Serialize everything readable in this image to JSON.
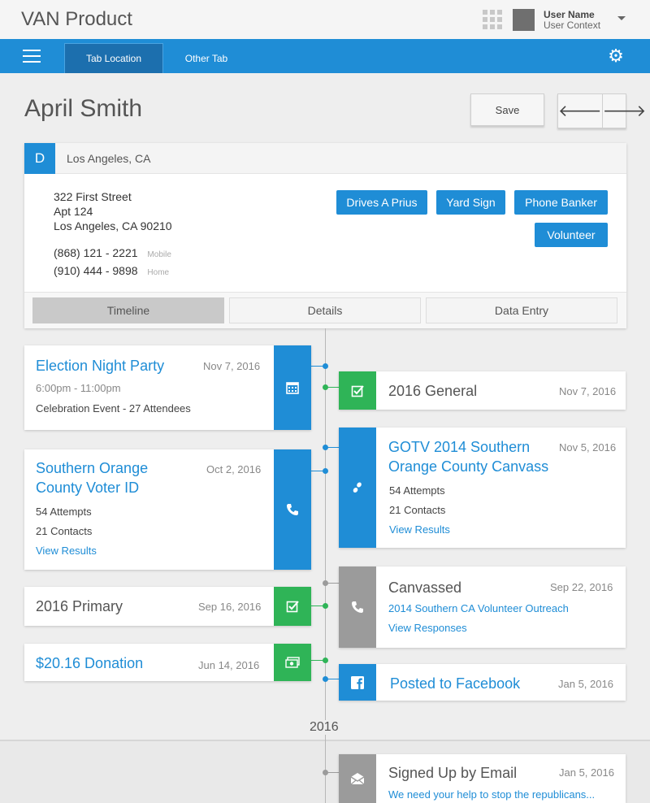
{
  "app": {
    "brand": "VAN Product",
    "user_name": "User Name",
    "user_context": "User Context"
  },
  "nav": {
    "tabs": [
      "Tab Location",
      "Other Tab"
    ]
  },
  "person": {
    "name": "April Smith",
    "save_label": "Save",
    "prev_glyph": "🡐",
    "next_glyph": "🡒",
    "party_badge": "D",
    "city_header": "Los Angeles, CA",
    "address": [
      "322 First Street",
      "Apt 124",
      "Los Angeles, CA 90210"
    ],
    "phones": [
      {
        "number": "(868) 121 - 2221",
        "type": "Mobile"
      },
      {
        "number": "(910) 444 - 9898",
        "type": "Home"
      }
    ],
    "tags": [
      "Drives A Prius",
      "Yard Sign",
      "Phone Banker",
      "Volunteer"
    ],
    "card_tabs": [
      "Timeline",
      "Details",
      "Data Entry"
    ]
  },
  "timeline": {
    "year_marker": "2016",
    "left": [
      {
        "title": "Election Night Party",
        "date": "Nov 7, 2016",
        "line1": "6:00pm - 11:00pm",
        "line2": "Celebration Event - 27 Attendees",
        "icon": "calendar-icon"
      },
      {
        "title": "Southern Orange County Voter ID",
        "date": "Oct 2, 2016",
        "line1": "54 Attempts",
        "line2": "21 Contacts",
        "link": "View Results",
        "icon": "phone-icon"
      },
      {
        "title": "2016 Primary",
        "date": "Sep 16, 2016",
        "icon": "check-icon"
      },
      {
        "title": "$20.16 Donation",
        "date": "Jun 14, 2016",
        "icon": "cash-icon"
      }
    ],
    "right": [
      {
        "title": "2016 General",
        "date": "Nov 7, 2016",
        "icon": "check-icon"
      },
      {
        "title": "GOTV 2014 Southern Orange County Canvass",
        "date": "Nov 5, 2016",
        "line1": "54 Attempts",
        "line2": "21 Contacts",
        "link": "View Results",
        "icon": "footsteps-icon"
      },
      {
        "title": "Canvassed",
        "date": "Sep 22, 2016",
        "line1": "2014 Southern CA Volunteer Outreach",
        "link": "View Responses",
        "icon": "phone-icon"
      },
      {
        "title": "Posted to Facebook",
        "date": "Jan 5, 2016",
        "icon": "facebook-icon"
      },
      {
        "title": "Signed Up by Email",
        "date": "Jan 5, 2016",
        "line1": "We need your help to stop the republicans...",
        "icon": "email-icon"
      }
    ]
  },
  "colors": {
    "primary": "#1f8dd6",
    "primary_dark": "#1c6fae",
    "green": "#2fb457",
    "gray_icon": "#9b9b9b",
    "background": "#eeeeee"
  }
}
